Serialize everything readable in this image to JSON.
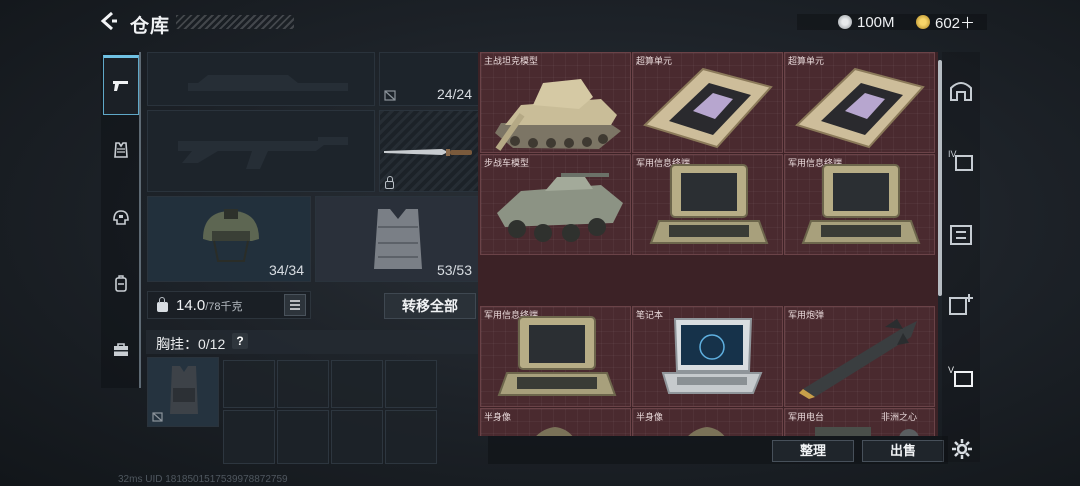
{
  "header": {
    "title": "仓库",
    "currency_1": "100M",
    "currency_2": "602＋"
  },
  "equipment": {
    "ammo_count": "24/24",
    "helmet_count": "34/34",
    "armor_count": "53/53",
    "weight_value": "14.0",
    "weight_max": "/78千克",
    "transfer_all": "转移全部",
    "chest_rig_label": "胸挂：0/12",
    "help": "?"
  },
  "storage": {
    "items": [
      {
        "name": "主战坦克模型",
        "icon": "tank-icon"
      },
      {
        "name": "超算单元",
        "icon": "supercomputer-icon"
      },
      {
        "name": "超算单元",
        "icon": "supercomputer-icon"
      },
      {
        "name": "步战车模型",
        "icon": "ifv-icon"
      },
      {
        "name": "军用信息终端",
        "icon": "terminal-icon"
      },
      {
        "name": "军用信息终端",
        "icon": "terminal-icon"
      },
      {
        "name": "军用信息终端",
        "icon": "terminal-icon"
      },
      {
        "name": "笔记本",
        "icon": "laptop-icon"
      },
      {
        "name": "军用炮弹",
        "icon": "missile-icon"
      },
      {
        "name": "半身像",
        "icon": "bust-icon"
      },
      {
        "name": "半身像",
        "icon": "bust-icon"
      },
      {
        "name": "军用电台",
        "icon": "radio-icon"
      },
      {
        "name": "非洲之心",
        "icon": "gem-icon"
      }
    ],
    "sort_button": "整理",
    "sell_button": "出售"
  },
  "footer": {
    "info": "32ms  UID 1818501517539978872759"
  },
  "colors": {
    "overlay_bg": "#3c2226",
    "tab_accent": "#6fc1e3",
    "coin_gold": "#d8b24a"
  }
}
